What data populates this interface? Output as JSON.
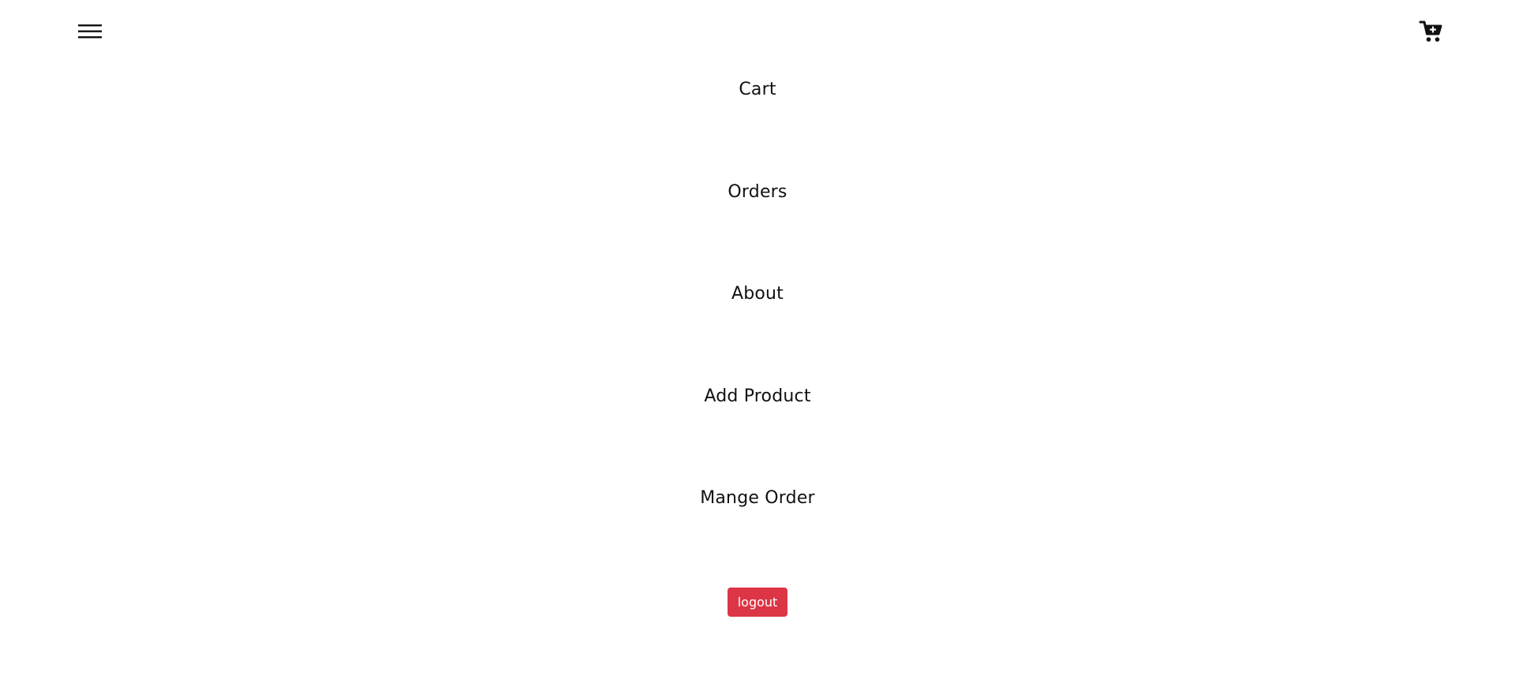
{
  "header": {
    "menu_icon": "hamburger-menu-icon",
    "cart_icon": "cart-icon"
  },
  "nav": {
    "items": [
      {
        "label": "Cart"
      },
      {
        "label": "Orders"
      },
      {
        "label": "About"
      },
      {
        "label": "Add Product"
      },
      {
        "label": "Mange Order"
      }
    ],
    "logout_label": "logout"
  },
  "colors": {
    "logout_background": "#dc3545",
    "logout_text": "#ffffff",
    "text": "#111111",
    "background": "#ffffff"
  }
}
